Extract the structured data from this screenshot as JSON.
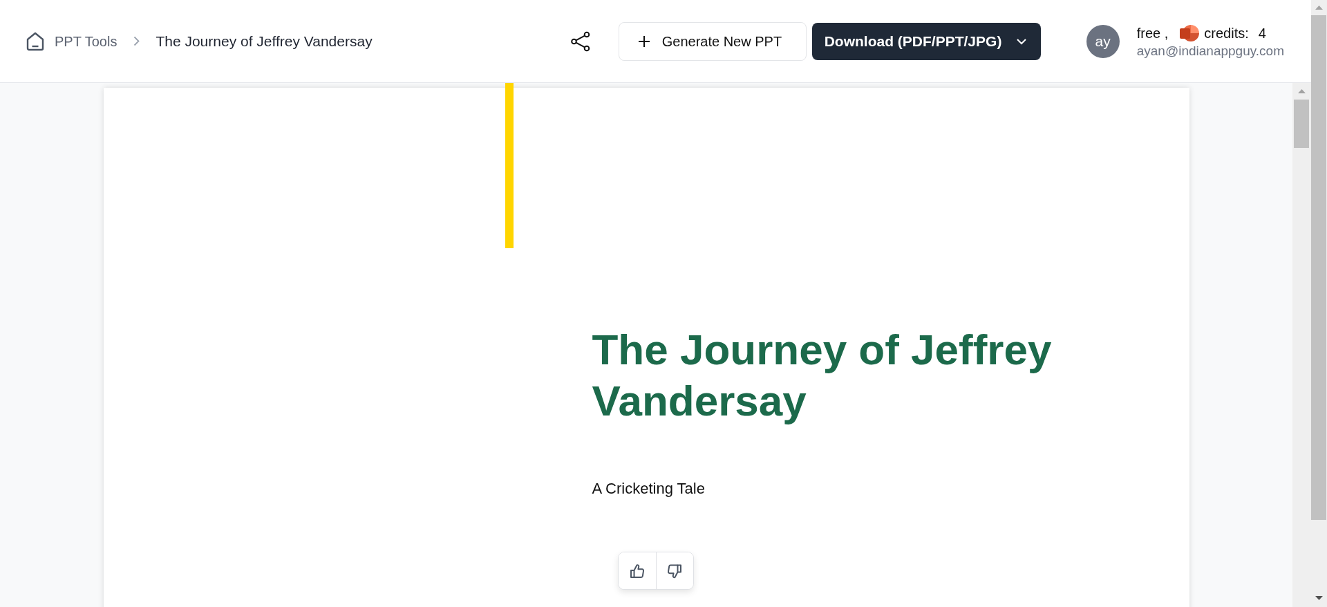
{
  "header": {
    "breadcrumb": [
      {
        "label": "PPT Tools",
        "kind": "home"
      },
      {
        "label": "The Journey of Jeffrey Vandersay",
        "kind": "current"
      }
    ],
    "actions": {
      "generate": "Generate New PPT",
      "download": "Download (PDF/PPT/JPG)"
    },
    "user": {
      "initials": "ay",
      "plan": "free ,",
      "credits_label": "credits:",
      "credits": "4",
      "email": "ayan@indianappguy.com"
    }
  },
  "slide": {
    "title": "The Journey of Jeffrey Vandersay",
    "subtitle": "A Cricketing Tale"
  }
}
